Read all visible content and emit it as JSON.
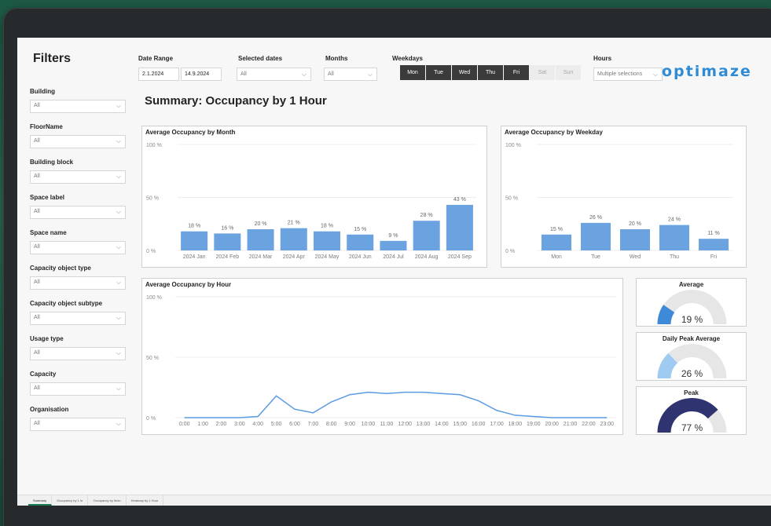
{
  "sidebar": {
    "title": "Filters",
    "filters": [
      {
        "label": "Building",
        "value": "All"
      },
      {
        "label": "FloorName",
        "value": "All"
      },
      {
        "label": "Building block",
        "value": "All"
      },
      {
        "label": "Space label",
        "value": "All"
      },
      {
        "label": "Space name",
        "value": "All"
      },
      {
        "label": "Capacity object type",
        "value": "All"
      },
      {
        "label": "Capacity object subtype",
        "value": "All"
      },
      {
        "label": "Usage type",
        "value": "All"
      },
      {
        "label": "Capacity",
        "value": "All"
      },
      {
        "label": "Organisation",
        "value": "All"
      }
    ]
  },
  "topbar": {
    "date_range_label": "Date Range",
    "date_start": "2.1.2024",
    "date_end": "14.9.2024",
    "selected_dates_label": "Selected dates",
    "selected_dates_value": "All",
    "months_label": "Months",
    "months_value": "All",
    "weekdays_label": "Weekdays",
    "weekdays": [
      {
        "label": "Mon",
        "selected": true
      },
      {
        "label": "Tue",
        "selected": true
      },
      {
        "label": "Wed",
        "selected": true
      },
      {
        "label": "Thu",
        "selected": true
      },
      {
        "label": "Fri",
        "selected": true
      },
      {
        "label": "Sat",
        "selected": false
      },
      {
        "label": "Sun",
        "selected": false
      }
    ],
    "hours_label": "Hours",
    "hours_value": "Multiple selections"
  },
  "logo": "optimaze",
  "page_title": "Summary: Occupancy by 1 Hour",
  "panels": {
    "month_title": "Average Occupancy by Month",
    "weekday_title": "Average Occupancy by Weekday",
    "hour_title": "Average Occupancy by Hour",
    "gauge_average_title": "Average",
    "gauge_daily_peak_title": "Daily Peak Average",
    "gauge_peak_title": "Peak"
  },
  "colors": {
    "bar": "#6aa3e0",
    "line": "#5b9be3",
    "gauge_track": "#e6e6e6",
    "gauge_average": "#3f8ad8",
    "gauge_daily_peak": "#9fcbf3",
    "gauge_peak": "#2f3470",
    "weekday_on": "#3b3b3b",
    "weekday_off": "#ececec",
    "logo": "#2e8cd6"
  },
  "chart_data": [
    {
      "type": "bar",
      "title": "Average Occupancy by Month",
      "categories": [
        "2024 Jan",
        "2024 Feb",
        "2024 Mar",
        "2024 Apr",
        "2024 May",
        "2024 Jun",
        "2024 Jul",
        "2024 Aug",
        "2024 Sep"
      ],
      "values": [
        18,
        16,
        20,
        21,
        18,
        15,
        9,
        28,
        43
      ],
      "value_labels": [
        "18 %",
        "16 %",
        "20 %",
        "21 %",
        "18 %",
        "15 %",
        "9 %",
        "28 %",
        "43 %"
      ],
      "yticks": [
        "100 %",
        "50 %",
        "0 %"
      ],
      "ylim": [
        0,
        100
      ]
    },
    {
      "type": "bar",
      "title": "Average Occupancy by Weekday",
      "categories": [
        "Mon",
        "Tue",
        "Wed",
        "Thu",
        "Fri"
      ],
      "values": [
        15,
        26,
        20,
        24,
        11
      ],
      "value_labels": [
        "15 %",
        "26 %",
        "20 %",
        "24 %",
        "11 %"
      ],
      "yticks": [
        "100 %",
        "50 %",
        "0 %"
      ],
      "ylim": [
        0,
        100
      ]
    },
    {
      "type": "line",
      "title": "Average Occupancy by Hour",
      "x": [
        "0:00",
        "1:00",
        "2:00",
        "3:00",
        "4:00",
        "5:00",
        "6:00",
        "7:00",
        "8:00",
        "9:00",
        "10:00",
        "11:00",
        "12:00",
        "13:00",
        "14:00",
        "15:00",
        "16:00",
        "17:00",
        "18:00",
        "19:00",
        "20:00",
        "21:00",
        "22:00",
        "23:00"
      ],
      "values": [
        0,
        0,
        0,
        0,
        1,
        18,
        7,
        4,
        13,
        19,
        21,
        20,
        21,
        21,
        20,
        19,
        14,
        6,
        2,
        1,
        0,
        0,
        0,
        0
      ],
      "yticks": [
        "100 %",
        "50 %",
        "0 %"
      ],
      "ylim": [
        0,
        100
      ]
    },
    {
      "type": "gauge",
      "title": "Average",
      "value": 19,
      "label": "19 %",
      "max": 100
    },
    {
      "type": "gauge",
      "title": "Daily Peak Average",
      "value": 26,
      "label": "26 %",
      "max": 100
    },
    {
      "type": "gauge",
      "title": "Peak",
      "value": 77,
      "label": "77 %",
      "max": 100
    }
  ],
  "tabs": [
    {
      "label": "Summary",
      "active": true
    },
    {
      "label": "Occupancy by 1 hr",
      "active": false
    },
    {
      "label": "Occupancy by 5min",
      "active": false
    },
    {
      "label": "Heatmap by 1 Hour",
      "active": false
    }
  ]
}
